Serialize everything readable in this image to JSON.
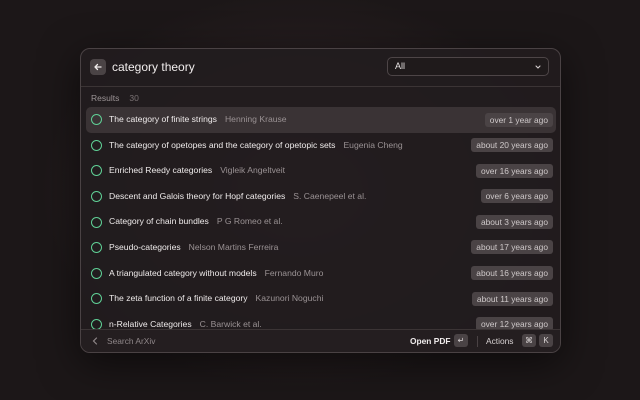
{
  "search": {
    "query": "category theory"
  },
  "filter": {
    "selected": "All"
  },
  "results_header": {
    "label": "Results",
    "count": "30"
  },
  "results": [
    {
      "title": "The category of finite strings",
      "author": "Henning Krause",
      "ago": "over 1 year ago",
      "selected": true
    },
    {
      "title": "The category of opetopes and the category of opetopic sets",
      "author": "Eugenia Cheng",
      "ago": "about 20 years ago"
    },
    {
      "title": "Enriched Reedy categories",
      "author": "Vigleik Angeltveit",
      "ago": "over 16 years ago"
    },
    {
      "title": "Descent and Galois theory for Hopf categories",
      "author": "S. Caenepeel et al.",
      "ago": "over 6 years ago"
    },
    {
      "title": "Category of chain bundles",
      "author": "P G Romeo et al.",
      "ago": "about 3 years ago"
    },
    {
      "title": "Pseudo-categories",
      "author": "Nelson Martins Ferreira",
      "ago": "about 17 years ago"
    },
    {
      "title": "A triangulated category without models",
      "author": "Fernando Muro",
      "ago": "about 16 years ago"
    },
    {
      "title": "The zeta function of a finite category",
      "author": "Kazunori Noguchi",
      "ago": "about 11 years ago"
    },
    {
      "title": "n-Relative Categories",
      "author": "C. Barwick et al.",
      "ago": "over 12 years ago"
    }
  ],
  "footer": {
    "search_label": "Search ArXiv",
    "open_label": "Open PDF",
    "open_key": "↵",
    "actions_label": "Actions",
    "actions_key1": "⌘",
    "actions_key2": "K"
  },
  "colors": {
    "accent_check": "#5fcf95"
  },
  "icons": {
    "back": "arrow-left-icon",
    "filter": "chevron-down-icon",
    "footer_back": "chevron-left-icon"
  }
}
